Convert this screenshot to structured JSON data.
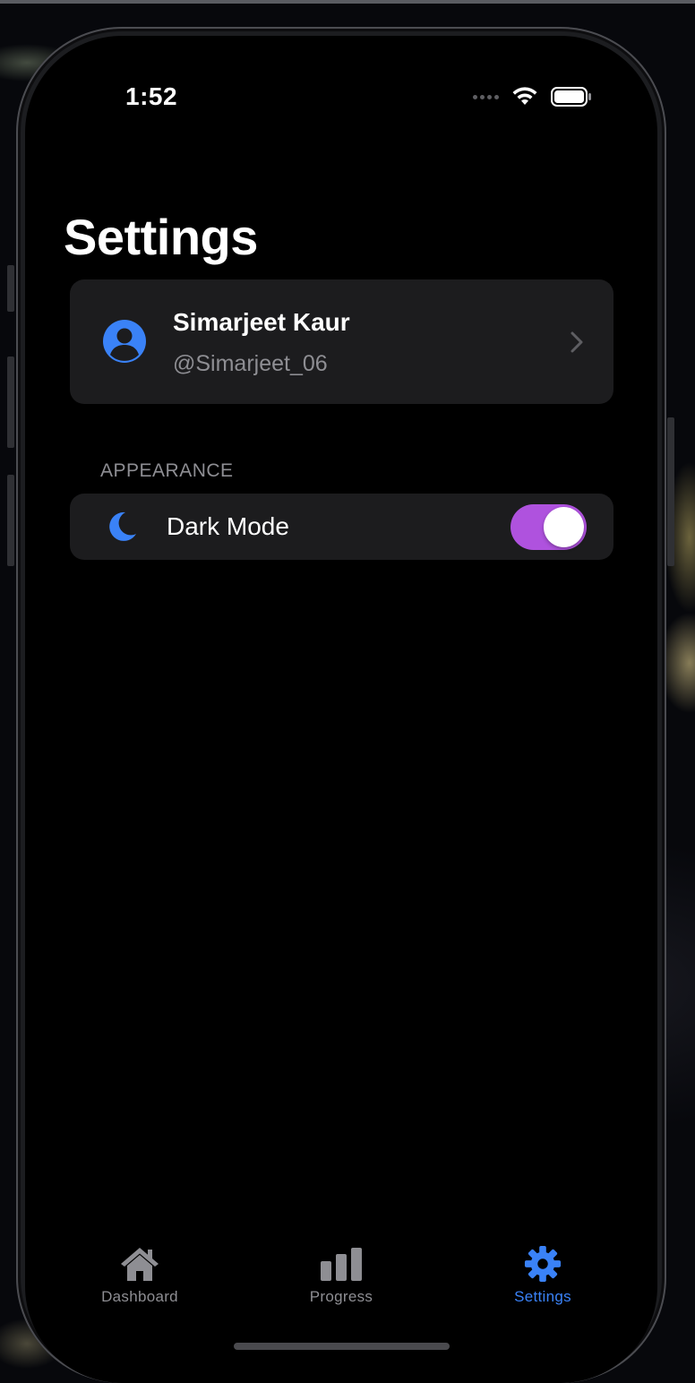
{
  "status_bar": {
    "time": "1:52"
  },
  "page": {
    "title": "Settings"
  },
  "profile": {
    "name": "Simarjeet Kaur",
    "handle": "@Simarjeet_06",
    "icon": "person-circle-icon"
  },
  "appearance": {
    "section_header": "APPEARANCE",
    "dark_mode_label": "Dark Mode",
    "dark_mode_enabled": true,
    "icon": "moon-icon"
  },
  "tab_bar": {
    "tabs": [
      {
        "label": "Dashboard",
        "icon": "house-icon",
        "selected": false
      },
      {
        "label": "Progress",
        "icon": "bar-chart-icon",
        "selected": false
      },
      {
        "label": "Settings",
        "icon": "gear-icon",
        "selected": true
      }
    ]
  },
  "colors": {
    "accent_blue": "#3a82f7",
    "toggle_on": "#af52de",
    "card_bg": "#1c1c1e",
    "secondary_text": "#8e8e93",
    "inactive_tab": "#8e8e93"
  }
}
